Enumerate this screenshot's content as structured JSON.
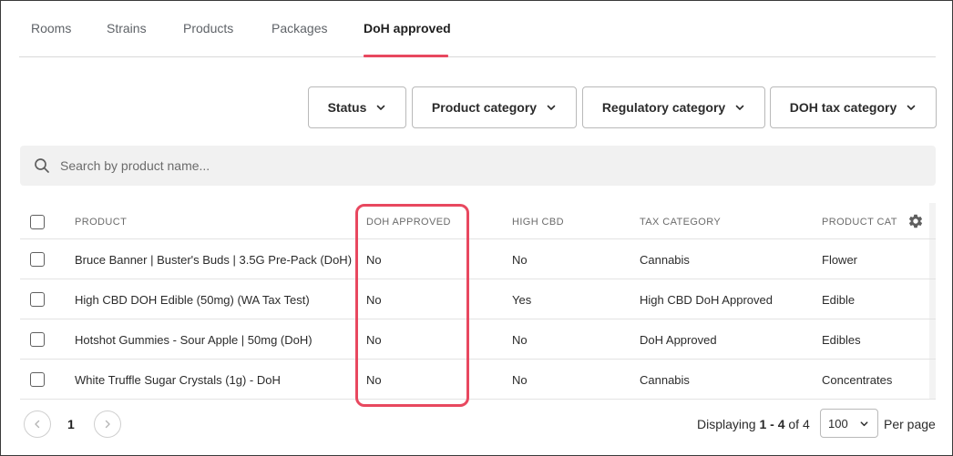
{
  "tabs": [
    {
      "label": "Rooms",
      "active": false
    },
    {
      "label": "Strains",
      "active": false
    },
    {
      "label": "Products",
      "active": false
    },
    {
      "label": "Packages",
      "active": false
    },
    {
      "label": "DoH approved",
      "active": true
    }
  ],
  "filters": {
    "status": "Status",
    "product_category": "Product category",
    "regulatory_category": "Regulatory category",
    "doh_tax_category": "DOH tax category"
  },
  "search": {
    "placeholder": "Search by product name..."
  },
  "table": {
    "columns": [
      "PRODUCT",
      "DOH APPROVED",
      "HIGH CBD",
      "TAX CATEGORY",
      "PRODUCT CAT"
    ],
    "rows": [
      {
        "product": "Bruce Banner | Buster's Buds | 3.5G Pre-Pack (DoH)",
        "doh_approved": "No",
        "high_cbd": "No",
        "tax_category": "Cannabis",
        "product_category": "Flower"
      },
      {
        "product": "High CBD DOH Edible (50mg) (WA Tax Test)",
        "doh_approved": "No",
        "high_cbd": "Yes",
        "tax_category": "High CBD DoH Approved",
        "product_category": "Edible"
      },
      {
        "product": "Hotshot Gummies - Sour Apple | 50mg (DoH)",
        "doh_approved": "No",
        "high_cbd": "No",
        "tax_category": "DoH Approved",
        "product_category": "Edibles"
      },
      {
        "product": "White Truffle Sugar Crystals (1g) - DoH",
        "doh_approved": "No",
        "high_cbd": "No",
        "tax_category": "Cannabis",
        "product_category": "Concentrates"
      }
    ]
  },
  "pagination": {
    "current_page": "1",
    "displaying_prefix": "Displaying ",
    "range": "1 - 4",
    "of_text": " of 4",
    "per_page_value": "100",
    "per_page_label": "Per page"
  },
  "colors": {
    "accent": "#e8485f",
    "search_bg": "#f1f1f1",
    "border": "#b9b9b9"
  }
}
